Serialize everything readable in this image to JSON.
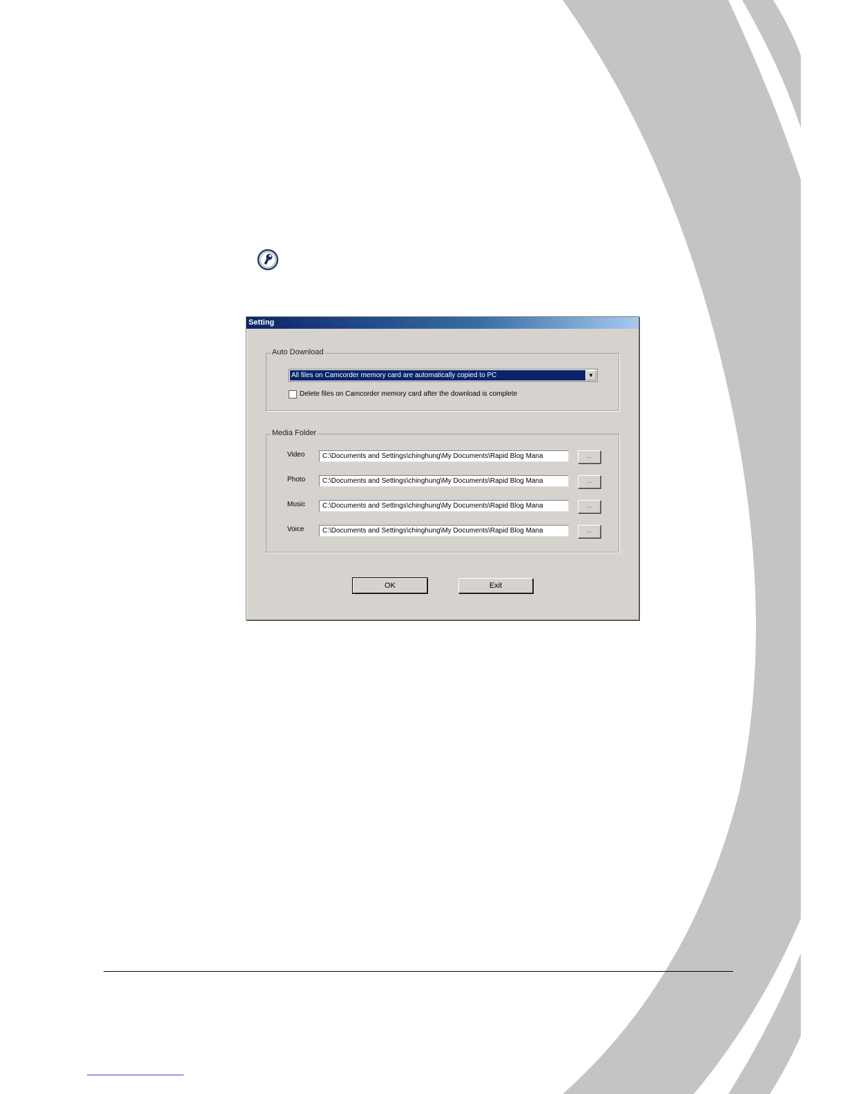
{
  "dialog": {
    "title": "Setting",
    "auto_download": {
      "legend": "Auto Download",
      "mode_selected": "All files on Camcorder memory card are automatically copied to PC",
      "delete_after_label": "Delete files on Camcorder memory card after the download is complete",
      "delete_after_checked": false
    },
    "media_folder": {
      "legend": "Media Folder",
      "rows": [
        {
          "label": "Video",
          "path": "C:\\Documents and Settings\\chinghung\\My Documents\\Rapid Blog Mana",
          "browse_label": "..."
        },
        {
          "label": "Photo",
          "path": "C:\\Documents and Settings\\chinghung\\My Documents\\Rapid Blog Mana",
          "browse_label": "..."
        },
        {
          "label": "Music",
          "path": "C:\\Documents and Settings\\chinghung\\My Documents\\Rapid Blog Mana",
          "browse_label": "..."
        },
        {
          "label": "Voice",
          "path": "C:\\Documents and Settings\\chinghung\\My Documents\\Rapid Blog Mana",
          "browse_label": "..."
        }
      ]
    },
    "ok_label": "OK",
    "exit_label": "Exit"
  },
  "icons": {
    "settings": "wrench-icon",
    "dropdown": "chevron-down-icon"
  },
  "colors": {
    "dialog_bg": "#d6d3ce",
    "titlebar_start": "#0a246a",
    "selection": "#0a246a",
    "decoration": "#c4c4c4"
  }
}
